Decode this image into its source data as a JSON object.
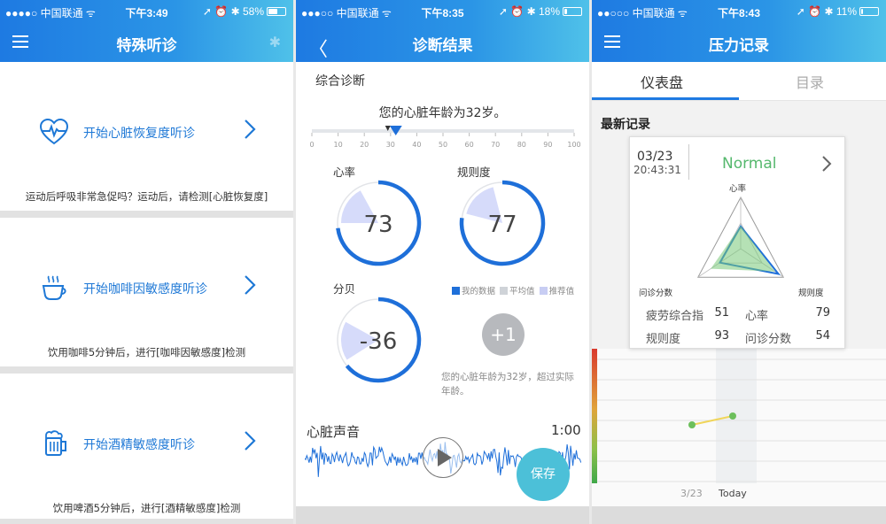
{
  "status_bars": [
    {
      "carrier": "●●●●○ 中国联通 ᯤ",
      "time": "下午3:49",
      "battery": "58%",
      "battery_level": 0.58
    },
    {
      "carrier": "●●●○○ 中国联通 ᯤ",
      "time": "下午8:35",
      "battery": "18%",
      "battery_level": 0.18
    },
    {
      "carrier": "●●○○○ 中国联通 ᯤ",
      "time": "下午8:43",
      "battery": "11%",
      "battery_level": 0.11
    }
  ],
  "status_icons": "➚ ⏰ ✱",
  "screen1": {
    "title": "特殊听诊",
    "items": [
      {
        "icon": "heart-pulse-icon",
        "label": "开始心脏恢复度听诊",
        "desc": "运动后呼吸非常急促吗？运动后，请检测[心脏恢复度]"
      },
      {
        "icon": "coffee-cup-icon",
        "label": "开始咖啡因敏感度听诊",
        "desc": "饮用咖啡5分钟后，进行[咖啡因敏感度]检测"
      },
      {
        "icon": "beer-mug-icon",
        "label": "开始酒精敏感度听诊",
        "desc": "饮用啤酒5分钟后，进行[酒精敏感度]检测"
      }
    ]
  },
  "screen2": {
    "title": "诊断结果",
    "section_title": "综合诊断",
    "age_text": "您的心脏年龄为32岁。",
    "scale_ticks": [
      "0",
      "10",
      "20",
      "30",
      "40",
      "50",
      "60",
      "70",
      "80",
      "90",
      "100"
    ],
    "scale_value": 32,
    "gauges": [
      {
        "label": "心率",
        "value": "73",
        "fraction": 0.73
      },
      {
        "label": "规则度",
        "value": "77",
        "fraction": 0.77
      },
      {
        "label": "分贝",
        "value": "-36",
        "fraction": 0.64
      }
    ],
    "legend": [
      "我的数据",
      "平均值",
      "推荐值"
    ],
    "plus_label": "+1",
    "note": "您的心脏年龄为32岁，超过实际年龄。",
    "sound_title": "心脏声音",
    "sound_time": "1:00",
    "save_label": "保存"
  },
  "screen3": {
    "title": "压力记录",
    "tabs": [
      "仪表盘",
      "目录"
    ],
    "section_title": "最新记录",
    "card": {
      "date": "03/23",
      "time": "20:43:31",
      "status": "Normal",
      "radar_labels": [
        "心率",
        "问诊分数",
        "规则度"
      ],
      "stats": [
        {
          "name": "疲劳综合指",
          "value": "51"
        },
        {
          "name": "心率",
          "value": "79"
        },
        {
          "name": "规则度",
          "value": "93"
        },
        {
          "name": "问诊分数",
          "value": "54"
        }
      ]
    },
    "x_labels": [
      "3/23",
      "Today"
    ]
  },
  "colors": {
    "accent": "#1e7ae2",
    "normal": "#55b86d",
    "save": "#4cc0d8"
  }
}
